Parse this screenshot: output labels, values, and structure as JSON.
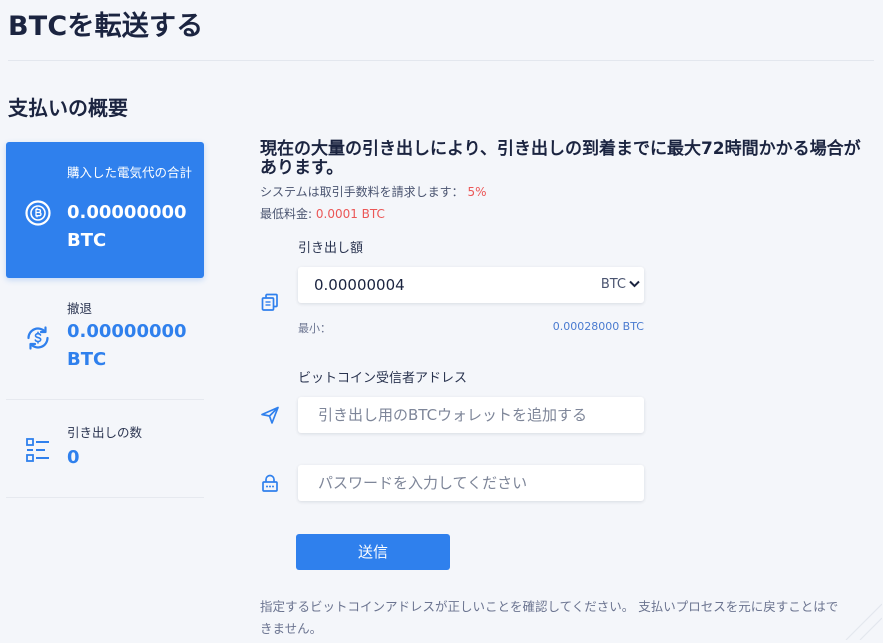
{
  "header": {
    "title": "BTCを転送する"
  },
  "summary": {
    "title": "支払いの概要",
    "cards": [
      {
        "label": "購入した電気代の合計",
        "value": "0.00000000 BTC",
        "icon": "bitcoin-circle-icon"
      },
      {
        "label": "撤退",
        "value": "0.00000000 BTC",
        "icon": "dollar-refresh-icon"
      },
      {
        "label": "引き出しの数",
        "value": "0",
        "icon": "list-icon"
      }
    ]
  },
  "notice": {
    "heading": "現在の大量の引き出しにより、引き出しの到着までに最大72時間かかる場合があります。",
    "fee_label": "システムは取引手数料を請求します：",
    "fee_value": "5%",
    "min_fee_label": "最低料金:",
    "min_fee_value": "0.0001 BTC"
  },
  "form": {
    "amount_label": "引き出し額",
    "amount_value": "0.00000004",
    "amount_unit": "BTC",
    "min_label": "最小：",
    "min_value": "0.00028000 BTC",
    "address_label": "ビットコイン受信者アドレス",
    "address_placeholder": "引き出し用のBTCウォレットを追加する",
    "password_placeholder": "パスワードを入力してください",
    "submit_label": "送信"
  },
  "footer": {
    "note": "指定するビットコインアドレスが正しいことを確認してください。 支払いプロセスを元に戻すことはできません。"
  },
  "colors": {
    "accent": "#2f80ed",
    "highlight": "#eb5757",
    "background": "#f4f6fa"
  }
}
